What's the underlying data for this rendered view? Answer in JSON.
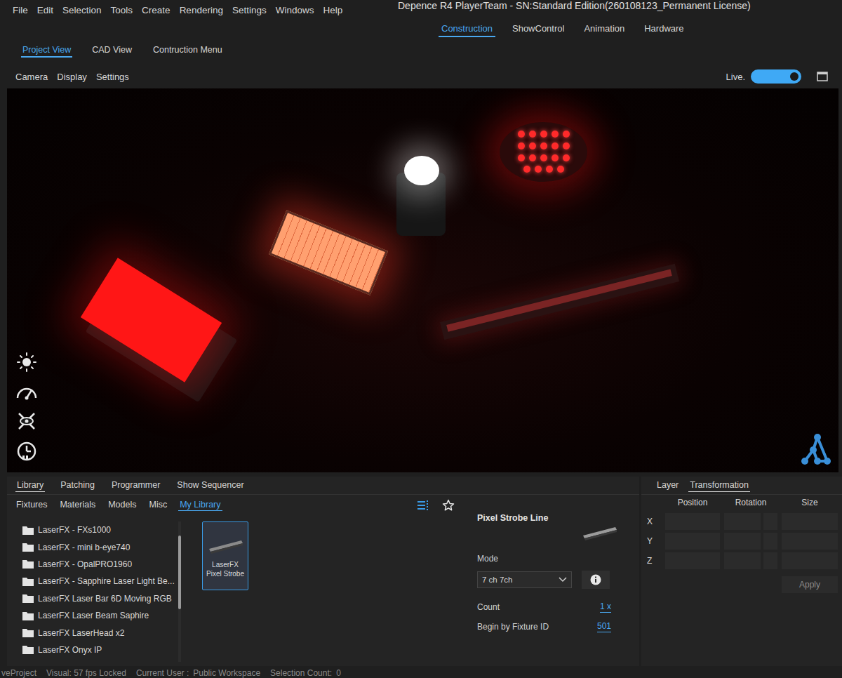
{
  "window": {
    "title": "Depence R4 PlayerTeam - SN:Standard Edition(260108123_Permanent License)"
  },
  "menu": [
    "File",
    "Edit",
    "Selection",
    "Tools",
    "Create",
    "Rendering",
    "Settings",
    "Windows",
    "Help"
  ],
  "mode_tabs": [
    {
      "label": "Construction",
      "selected": true
    },
    {
      "label": "ShowControl",
      "selected": false
    },
    {
      "label": "Animation",
      "selected": false
    },
    {
      "label": "Hardware",
      "selected": false
    }
  ],
  "view_tabs": [
    {
      "label": "Project View",
      "selected": true
    },
    {
      "label": "CAD View",
      "selected": false
    },
    {
      "label": "Contruction Menu",
      "selected": false
    }
  ],
  "viewport_menu": [
    "Camera",
    "Display",
    "Settings"
  ],
  "live": {
    "label": "Live.",
    "on": true
  },
  "panel_tabs": [
    {
      "label": "Library",
      "selected": true
    },
    {
      "label": "Patching",
      "selected": false
    },
    {
      "label": "Programmer",
      "selected": false
    },
    {
      "label": "Show Sequencer",
      "selected": false
    }
  ],
  "library_tabs": [
    {
      "label": "Fixtures",
      "selected": false
    },
    {
      "label": "Materials",
      "selected": false
    },
    {
      "label": "Models",
      "selected": false
    },
    {
      "label": "Misc",
      "selected": false
    },
    {
      "label": "My Library",
      "selected": true
    }
  ],
  "folders": [
    "LaserFX - FXs1000",
    "LaserFX - mini b-eye740",
    "LaserFX - OpalPRO1960",
    "LaserFX - Sapphire Laser Light Be...",
    "LaserFX Laser Bar 6D Moving RGB",
    "LaserFX Laser Beam Saphire",
    "LaserFX LaserHead x2",
    "LaserFX Onyx IP"
  ],
  "items": [
    {
      "label": "LaserFX Pixel Strobe",
      "selected": true
    }
  ],
  "details": {
    "title": "Pixel Strobe Line",
    "mode_label": "Mode",
    "mode": "7 ch 7ch",
    "count_label": "Count",
    "count": "1 x",
    "begin_label": "Begin by Fixture ID",
    "begin": "501"
  },
  "side_tabs": [
    {
      "label": "Layer",
      "selected": false
    },
    {
      "label": "Transformation",
      "selected": true
    }
  ],
  "transform": {
    "columns": [
      "Position",
      "Rotation",
      "Size"
    ],
    "rows": [
      "X",
      "Y",
      "Z"
    ],
    "apply": "Apply"
  },
  "status_bar": [
    "veProject",
    "Visual: 57 fps Locked",
    "Current User :",
    "Public Workspace",
    "Selection Count:",
    "0"
  ]
}
